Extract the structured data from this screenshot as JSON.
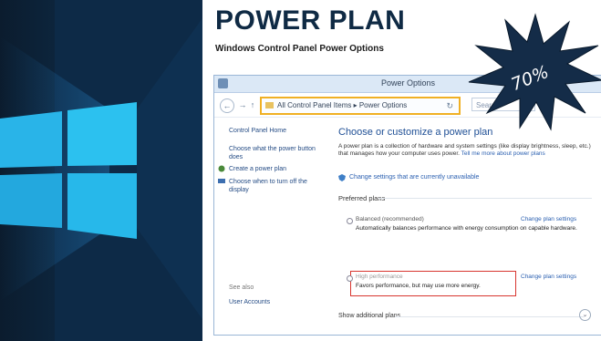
{
  "header": {
    "title": "POWER PLAN",
    "subtitle": "Windows Control Panel Power Options",
    "badge": "70%"
  },
  "window": {
    "title": "Power Options",
    "address": {
      "path": "All Control Panel Items  ▸  Power Options"
    },
    "search_placeholder": "Sear"
  },
  "sidebar": {
    "items": [
      {
        "label": "Control Panel Home"
      },
      {
        "label": "Choose what the power button does"
      },
      {
        "label": "Create a power plan"
      },
      {
        "label": "Choose when to turn off the display"
      }
    ],
    "see_also": "See also",
    "user_accounts": "User Accounts"
  },
  "main": {
    "heading": "Choose or customize a power plan",
    "description": "A power plan is a collection of hardware and system settings (like display brightness, sleep, etc.) that manages how your computer uses power.",
    "description_link": "Tell me more about power plans",
    "change_unavailable": "Change settings that are currently unavailable",
    "preferred_plans": "Preferred plans",
    "plans": [
      {
        "name": "Balanced (recommended)",
        "description": "Automatically balances performance with energy consumption on capable hardware.",
        "link": "Change plan settings"
      },
      {
        "name": "High performance",
        "description": "Favors performance, but may use more energy.",
        "link": "Change plan settings"
      }
    ],
    "show_additional": "Show additional plans"
  }
}
